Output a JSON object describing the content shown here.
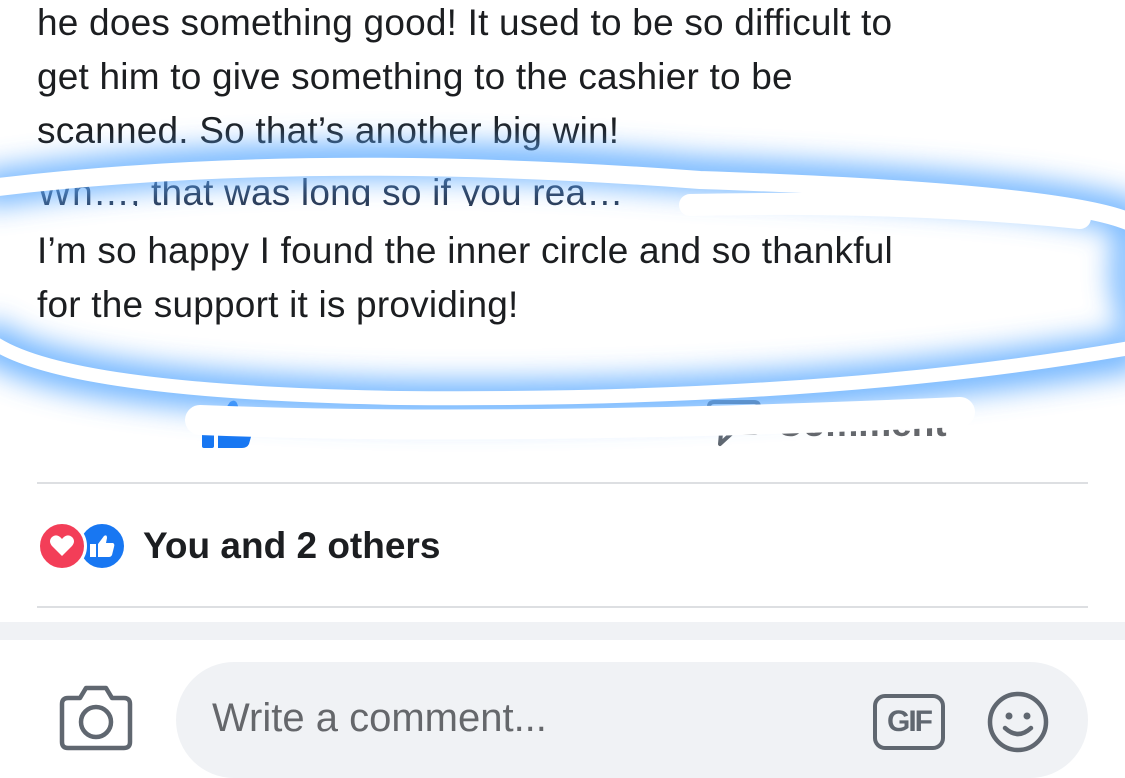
{
  "post": {
    "lines_top": [
      "he does something good! It used to be so difficult to",
      "get him to give something to the cashier to be",
      "scanned. So that’s another big win!"
    ],
    "partial_line": "Wh…, that was long so if you rea…",
    "lines_bottom": [
      "I’m so happy I found the inner circle and so thankful",
      "for the support it is providing!"
    ],
    "highlight_color": "#5aa9ff"
  },
  "actions": {
    "like_label": "Like",
    "comment_label": "Comment",
    "icon_color": "#1877f2"
  },
  "reactions": {
    "icons": [
      "heart-icon",
      "thumbs-up-icon"
    ],
    "summary": "You and 2 others",
    "heart_color": "#f33e58",
    "like_color": "#1877f2"
  },
  "composer": {
    "placeholder": "Write a comment...",
    "gif_label": "GIF",
    "icons": [
      "camera-icon",
      "gif-icon",
      "smiley-icon"
    ]
  }
}
